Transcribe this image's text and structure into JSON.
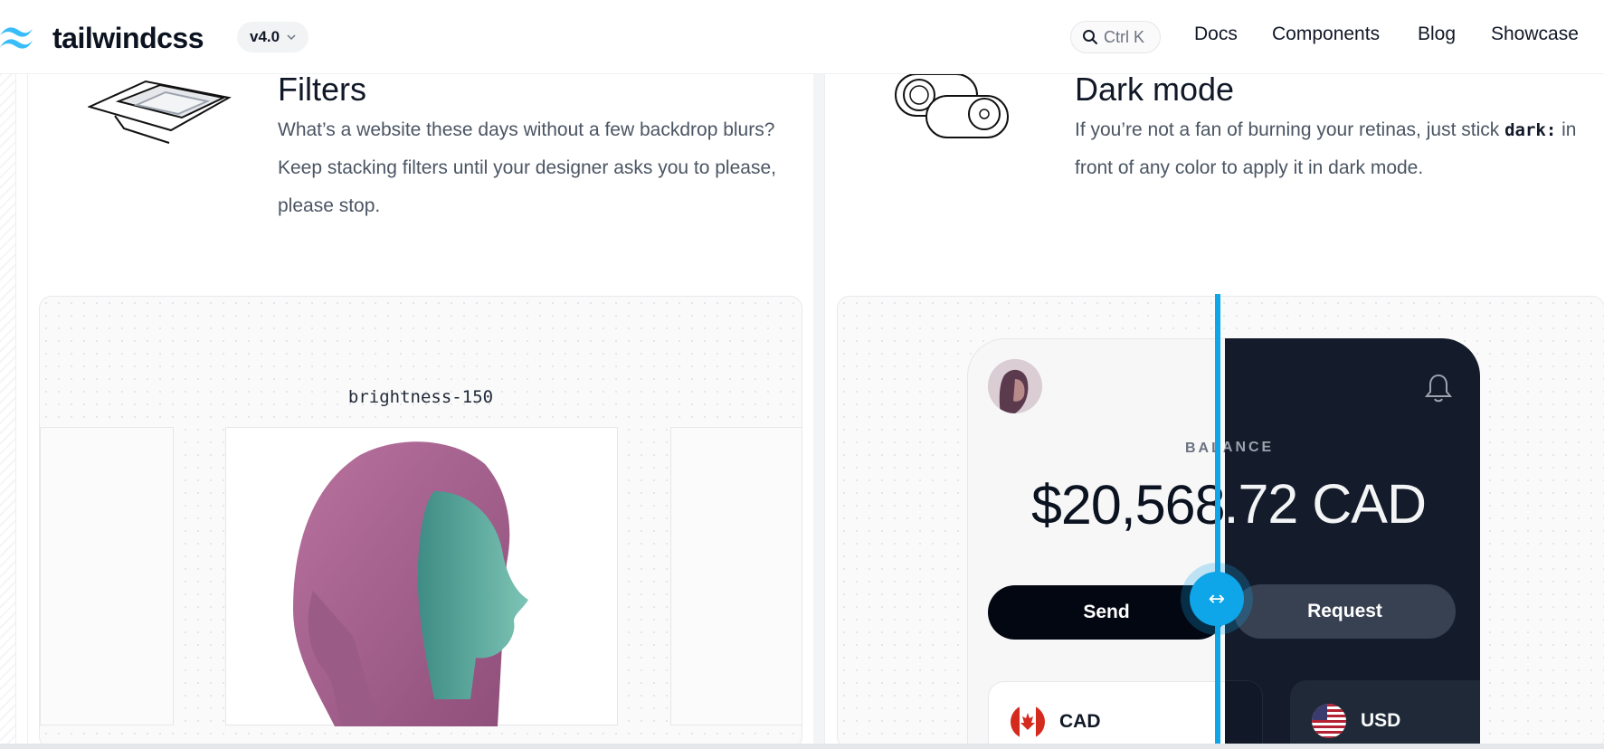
{
  "header": {
    "logo_text": "tailwindcss",
    "version": "v4.0",
    "search_shortcut": "Ctrl K",
    "nav": [
      "Docs",
      "Components",
      "Blog",
      "Showcase"
    ]
  },
  "filters": {
    "title": "Filters",
    "description": "What’s a website these days without a few backdrop blurs? Keep stacking filters until your designer asks you to please, please stop.",
    "demo_label": "brightness-150"
  },
  "dark_mode": {
    "title": "Dark mode",
    "description_before": "If you’re not a fan of burning your retinas, just stick",
    "code": "dark:",
    "description_after": "in front of any color to apply it in dark mode.",
    "balance_label": "BALANCE",
    "balance_amount": "$20,568.72 CAD",
    "send_label": "Send",
    "request_label": "Request",
    "currency_1": "CAD",
    "currency_2": "USD",
    "slider_icon": "↔"
  },
  "colors": {
    "accent": "#0ea5e9",
    "dark_surface": "#141b2a",
    "text": "#111827"
  }
}
